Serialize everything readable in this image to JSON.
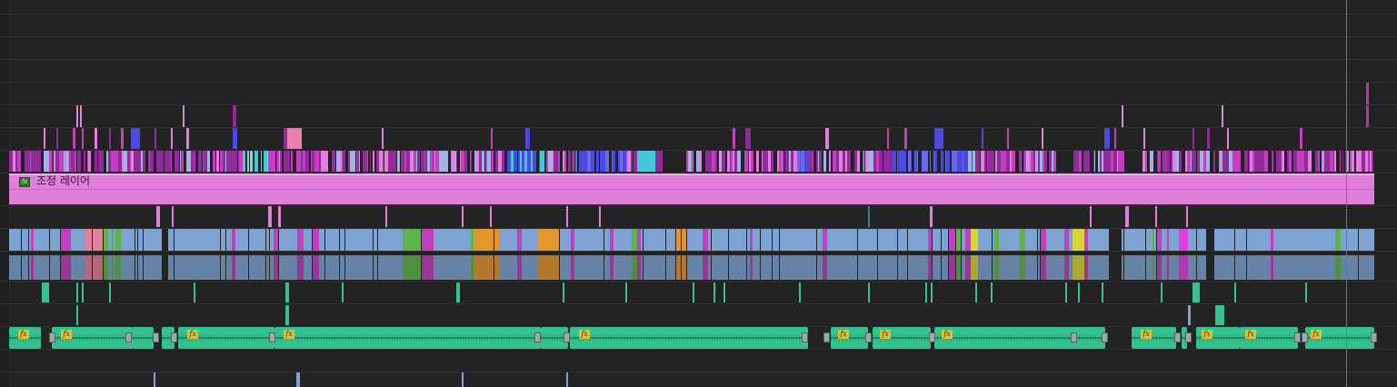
{
  "adjustment_layer": {
    "label": "조정 레이어",
    "fx": "fx",
    "color": "#e07fdc"
  },
  "audio_fx_label": "fx",
  "colors": {
    "background": "#232323",
    "magenta": "#c23fc0",
    "pink": "#e07fdc",
    "violet": "#8f2c9a",
    "blue": "#4a4ae0",
    "cyan": "#47c8d8",
    "steel_blue": "#7ea3d2",
    "orange": "#e3962f",
    "green": "#5db54a",
    "yellow": "#d8d43a",
    "teal": "#34c28e",
    "playhead": "#3a7fd0"
  }
}
